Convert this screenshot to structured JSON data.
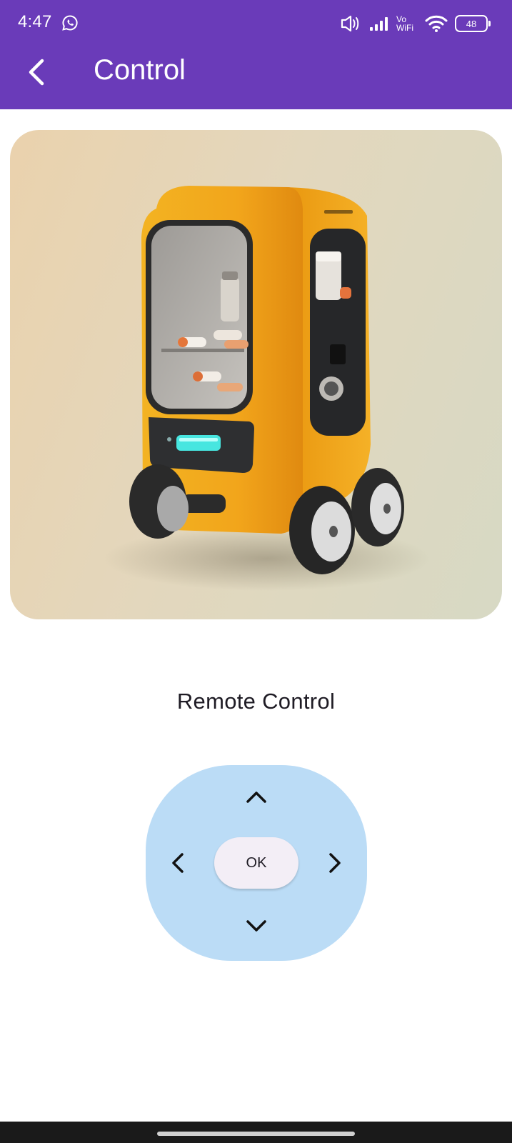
{
  "status_bar": {
    "time": "4:47",
    "network_label_top": "Vo",
    "network_label_bottom": "WiFi",
    "battery": "48",
    "icons": [
      "whatsapp-icon",
      "vibrate-icon",
      "signal-icon",
      "wifi-icon",
      "battery-icon"
    ]
  },
  "app_bar": {
    "title": "Control",
    "back_icon": "chevron-left-icon",
    "background": "#6a3bb9"
  },
  "hero_image": {
    "subject": "yellow medicine delivery robot"
  },
  "remote": {
    "title": "Remote Control",
    "ok_label": "OK",
    "up_icon": "chevron-up-icon",
    "down_icon": "chevron-down-icon",
    "left_icon": "chevron-left-icon",
    "right_icon": "chevron-right-icon",
    "pad_color": "#bbdcf6",
    "ok_color": "#f3eef6"
  }
}
